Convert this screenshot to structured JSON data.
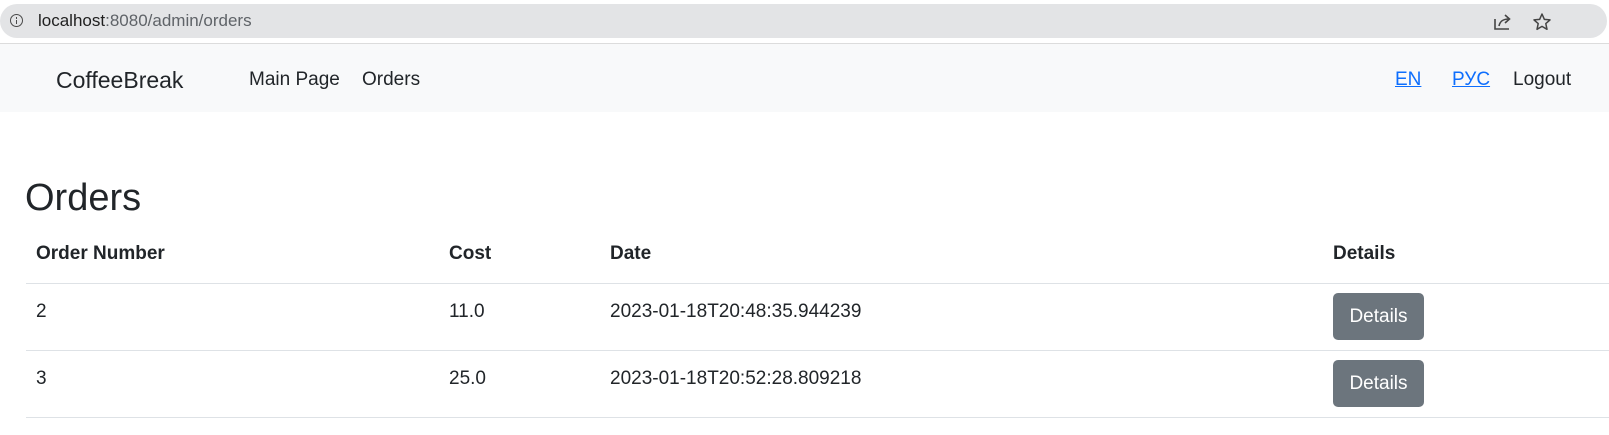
{
  "browser": {
    "url_host": "localhost",
    "url_rest": ":8080/admin/orders"
  },
  "navbar": {
    "brand": "CoffeeBreak",
    "links": [
      "Main Page",
      "Orders"
    ],
    "lang_en": "EN",
    "lang_ru": "РУС",
    "logout": "Logout"
  },
  "page": {
    "title": "Orders"
  },
  "table": {
    "headers": [
      "Order Number",
      "Cost",
      "Date",
      "Details"
    ],
    "rows": [
      {
        "number": "2",
        "cost": "11.0",
        "date": "2023-01-18T20:48:35.944239",
        "button": "Details"
      },
      {
        "number": "3",
        "cost": "25.0",
        "date": "2023-01-18T20:52:28.809218",
        "button": "Details"
      }
    ]
  },
  "colors": {
    "navbar_bg": "#f8f9fa",
    "link": "#0d6efd",
    "secondary_button": "#6c757d",
    "text": "#212529"
  }
}
